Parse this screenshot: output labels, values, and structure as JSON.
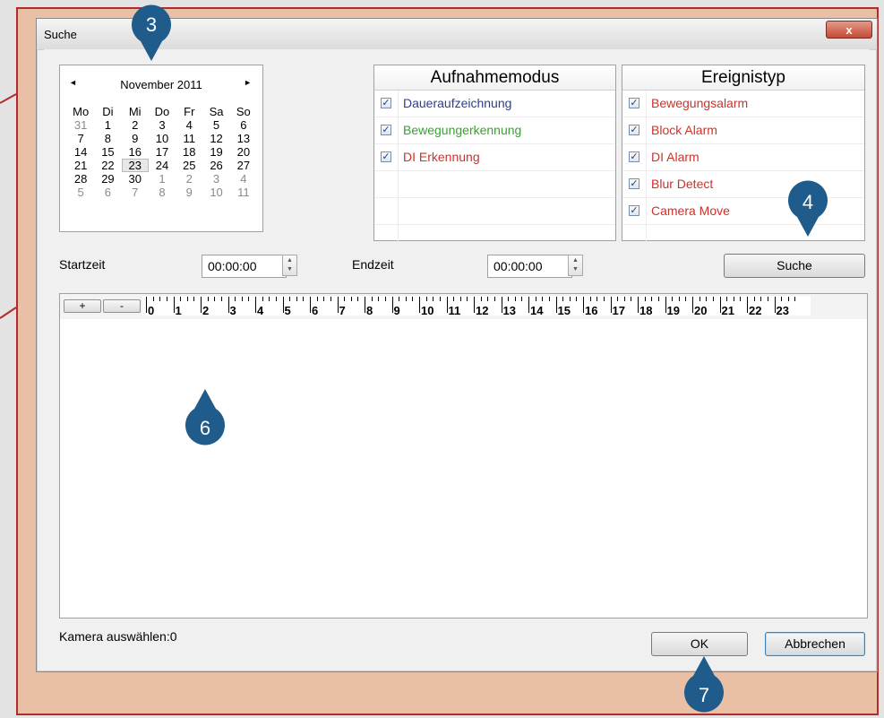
{
  "window": {
    "title": "Suche",
    "close_glyph": "x"
  },
  "calendar": {
    "prev_glyph": "◄",
    "next_glyph": "►",
    "month_title": "November 2011",
    "weekdays": [
      "Mo",
      "Di",
      "Mi",
      "Do",
      "Fr",
      "Sa",
      "So"
    ],
    "weeks": [
      [
        "31",
        "1",
        "2",
        "3",
        "4",
        "5",
        "6"
      ],
      [
        "7",
        "8",
        "9",
        "10",
        "11",
        "12",
        "13"
      ],
      [
        "14",
        "15",
        "16",
        "17",
        "18",
        "19",
        "20"
      ],
      [
        "21",
        "22",
        "23",
        "24",
        "25",
        "26",
        "27"
      ],
      [
        "28",
        "29",
        "30",
        "1",
        "2",
        "3",
        "4"
      ],
      [
        "5",
        "6",
        "7",
        "8",
        "9",
        "10",
        "11"
      ]
    ],
    "selected_day": "23"
  },
  "recording_mode": {
    "title": "Aufnahmemodus",
    "items": [
      {
        "label": "Daueraufzeichnung",
        "checked": true,
        "color": "#2b3f8f"
      },
      {
        "label": "Bewegungerkennung",
        "checked": true,
        "color": "#3aa032"
      },
      {
        "label": "DI Erkennung",
        "checked": true,
        "color": "#d0302a"
      }
    ]
  },
  "event_type": {
    "title": "Ereignistyp",
    "items": [
      {
        "label": "Bewegungsalarm",
        "checked": true,
        "color": "#d0302a"
      },
      {
        "label": "Block Alarm",
        "checked": true,
        "color": "#d0302a"
      },
      {
        "label": "DI Alarm",
        "checked": true,
        "color": "#d0302a"
      },
      {
        "label": "Blur Detect",
        "checked": true,
        "color": "#d0302a"
      },
      {
        "label": "Camera Move",
        "checked": true,
        "color": "#d0302a"
      }
    ]
  },
  "time": {
    "start_label": "Startzeit",
    "start_value": "00:00:00",
    "end_label": "Endzeit",
    "end_value": "00:00:00"
  },
  "buttons": {
    "search": "Suche",
    "zoom_in": "+",
    "zoom_out": "-",
    "ok": "OK",
    "cancel": "Abbrechen"
  },
  "timeline": {
    "hours": [
      "0",
      "1",
      "2",
      "3",
      "4",
      "5",
      "6",
      "7",
      "8",
      "9",
      "10",
      "11",
      "12",
      "13",
      "14",
      "15",
      "16",
      "17",
      "18",
      "19",
      "20",
      "21",
      "22",
      "23"
    ]
  },
  "status": {
    "camera_select": "Kamera auswählen:0"
  },
  "callouts": [
    {
      "number": "3"
    },
    {
      "number": "4"
    },
    {
      "number": "6"
    },
    {
      "number": "7"
    }
  ],
  "colors": {
    "frame_bg": "#e9bfa6",
    "frame_border": "#b22b2b",
    "badge": "#1f5c8c"
  }
}
